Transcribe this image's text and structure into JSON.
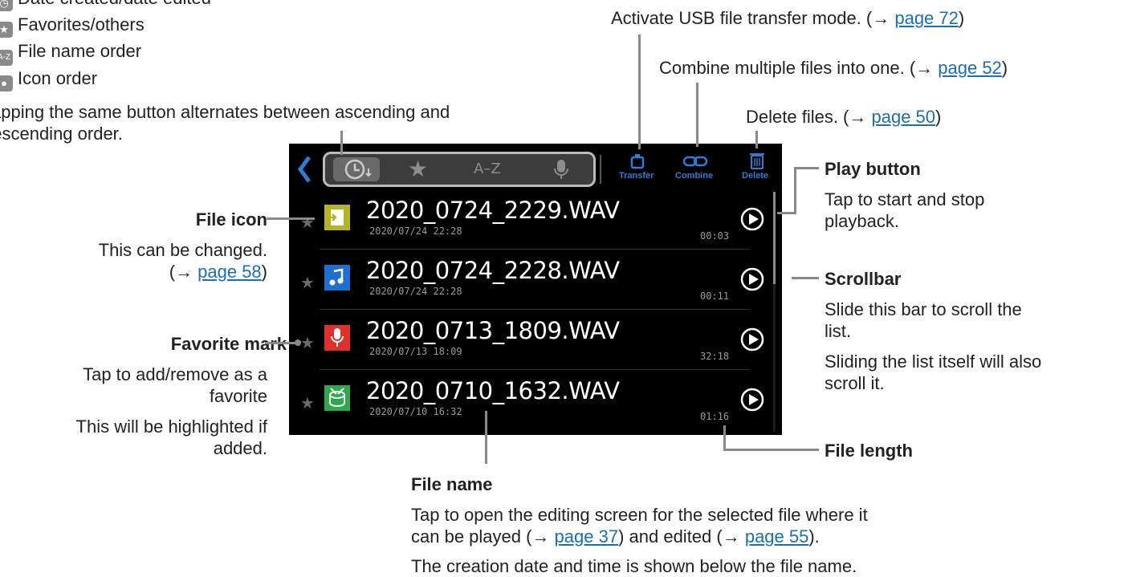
{
  "left_list": {
    "row0": "Date created/date edited",
    "row1": "Favorites/others",
    "row2": "File name order",
    "row3": "Icon order",
    "note_line1": "Tapping the same button alternates between ascending and",
    "note_line2": "descending order."
  },
  "callouts": {
    "usb": {
      "text": "Activate USB file transfer mode. (→ ",
      "link": "page 72",
      "close": ")"
    },
    "combine": {
      "text": "Combine multiple files into one. (→ ",
      "link": "page 52",
      "close": ")"
    },
    "delete": {
      "text": "Delete files. (→ ",
      "link": "page 50",
      "close": ")"
    },
    "play_title": "Play button",
    "play_l1": "Tap to start and stop",
    "play_l2": "playback.",
    "scroll_title": "Scrollbar",
    "scroll_l1": "Slide this bar to scroll the",
    "scroll_l2": "list.",
    "scroll_l3": "Sliding the list itself will also",
    "scroll_l4": "scroll it.",
    "length_title": "File length",
    "icon_title": "File icon",
    "icon_l1": "This can be changed.",
    "icon_l2": "(→ ",
    "icon_link": "page 58",
    "icon_close": ")",
    "fav_title": "Favorite mark",
    "fav_l1": "Tap to add/remove as a",
    "fav_l2": "favorite",
    "fav_l3": "This will be highlighted if",
    "fav_l4": "added.",
    "name_title": "File name",
    "name_l1": "Tap to open the editing screen for the selected file where it",
    "name_l2a": "can be played (→ ",
    "name_link1": "page 37",
    "name_l2b": ") and edited (→ ",
    "name_link2": "page 55",
    "name_l2c": ").",
    "name_l3": "The creation date and time is shown below the file name."
  },
  "screen": {
    "sort_az": "A–Z",
    "transfer": "Transfer",
    "combine": "Combine",
    "delete": "Delete",
    "files": [
      {
        "name": "2020_0724_2229.WAV",
        "date": "2020/07/24 22:28",
        "length": "00:03",
        "icon": "import-file-icon",
        "color": "#b5b524"
      },
      {
        "name": "2020_0724_2228.WAV",
        "date": "2020/07/24 22:28",
        "length": "00:11",
        "icon": "music-note-icon",
        "color": "#1e6fd0"
      },
      {
        "name": "2020_0713_1809.WAV",
        "date": "2020/07/13 18:09",
        "length": "32:18",
        "icon": "microphone-icon",
        "color": "#e0302a"
      },
      {
        "name": "2020_0710_1632.WAV",
        "date": "2020/07/10 16:32",
        "length": "01:16",
        "icon": "drum-icon",
        "color": "#2ea84a"
      }
    ]
  },
  "colors": {
    "accent": "#2f7cd6",
    "link": "#1a6fb5",
    "leader": "#8a8a8a"
  }
}
